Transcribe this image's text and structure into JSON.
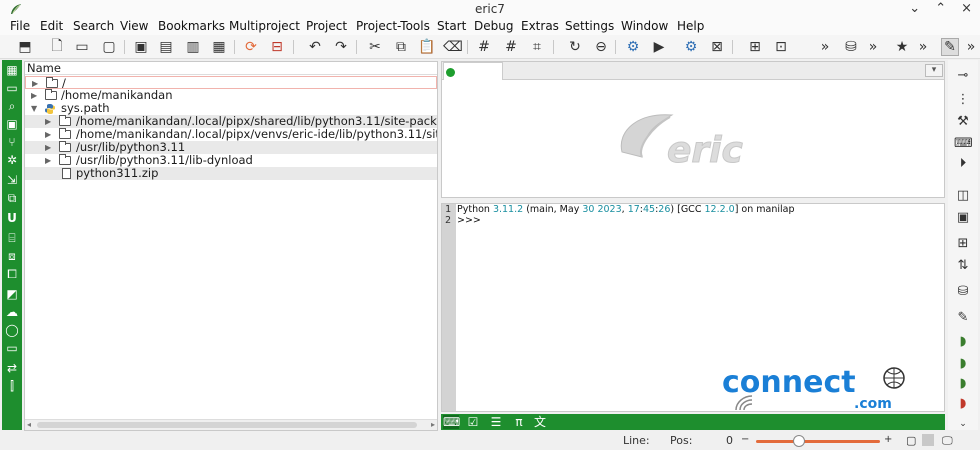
{
  "window": {
    "title": "eric7",
    "minimize": "⌄",
    "maximize": "⌃",
    "close": "×"
  },
  "menu": [
    "File",
    "Edit",
    "Search",
    "View",
    "Bookmarks",
    "Multiproject",
    "Project",
    "Project-Tools",
    "Start",
    "Debug",
    "Extras",
    "Settings",
    "Window",
    "Help"
  ],
  "toolbar": {
    "more": "»"
  },
  "file_browser": {
    "column_header": "Name",
    "rows": [
      {
        "text": "/",
        "kind": "folder",
        "level": 0,
        "expanded": false
      },
      {
        "text": "/home/manikandan",
        "kind": "folder",
        "level": 0,
        "expanded": false
      },
      {
        "text": "sys.path",
        "kind": "python",
        "level": 0,
        "expanded": true
      },
      {
        "text": "/home/manikandan/.local/pipx/shared/lib/python3.11/site-packages",
        "kind": "folder",
        "level": 1,
        "expanded": false
      },
      {
        "text": "/home/manikandan/.local/pipx/venvs/eric-ide/lib/python3.11/site-packages",
        "kind": "folder",
        "level": 1,
        "expanded": false
      },
      {
        "text": "/usr/lib/python3.11",
        "kind": "folder",
        "level": 1,
        "expanded": false
      },
      {
        "text": "/usr/lib/python3.11/lib-dynload",
        "kind": "folder",
        "level": 1,
        "expanded": false
      },
      {
        "text": "python311.zip",
        "kind": "file",
        "level": 1,
        "expanded": false
      }
    ]
  },
  "shell": {
    "lines": [
      {
        "no": "1",
        "parts": [
          {
            "t": "Python ",
            "c": ""
          },
          {
            "t": "3.11.2",
            "c": "num"
          },
          {
            "t": " (main, May ",
            "c": ""
          },
          {
            "t": "30",
            "c": "num"
          },
          {
            "t": " ",
            "c": ""
          },
          {
            "t": "2023",
            "c": "num"
          },
          {
            "t": ", ",
            "c": ""
          },
          {
            "t": "17",
            "c": "num"
          },
          {
            "t": ":",
            "c": ""
          },
          {
            "t": "45",
            "c": "num"
          },
          {
            "t": ":",
            "c": ""
          },
          {
            "t": "26",
            "c": "num"
          },
          {
            "t": ") [GCC ",
            "c": ""
          },
          {
            "t": "12.2.0",
            "c": "num"
          },
          {
            "t": "] on manilap",
            "c": ""
          }
        ]
      },
      {
        "no": "2",
        "parts": [
          {
            "t": ">>>",
            "c": ""
          }
        ]
      }
    ]
  },
  "logos": {
    "eric": "eric",
    "connect": "connect",
    "connect_com": ".com"
  },
  "statusbar": {
    "line_label": "Line:",
    "pos_label": "Pos:",
    "pos_value": "0",
    "zoom_fraction": 0.33
  },
  "colors": {
    "green": "#1e8e2e",
    "accent": "#e36b3b"
  }
}
